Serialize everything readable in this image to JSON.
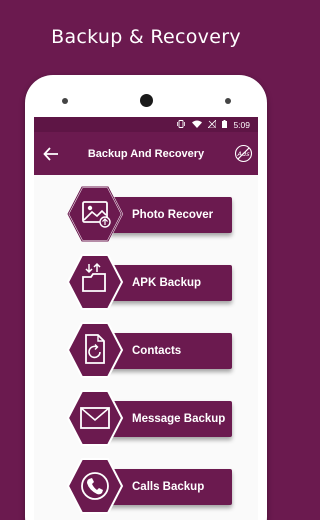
{
  "promo": {
    "title": "Backup & Recovery"
  },
  "status_bar": {
    "time": "5:09"
  },
  "app_bar": {
    "title": "Backup And Recovery",
    "ads_label": "Ads"
  },
  "menu": [
    {
      "label": "Photo Recover",
      "icon": "photo-upload-icon"
    },
    {
      "label": "APK Backup",
      "icon": "folder-download-icon"
    },
    {
      "label": "Contacts",
      "icon": "contacts-refresh-icon"
    },
    {
      "label": "Message Backup",
      "icon": "envelope-icon"
    },
    {
      "label": "Calls Backup",
      "icon": "phone-icon"
    }
  ],
  "colors": {
    "brand": "#6b1a4f",
    "status_bar": "#5e1545",
    "background": "#fafafa"
  }
}
